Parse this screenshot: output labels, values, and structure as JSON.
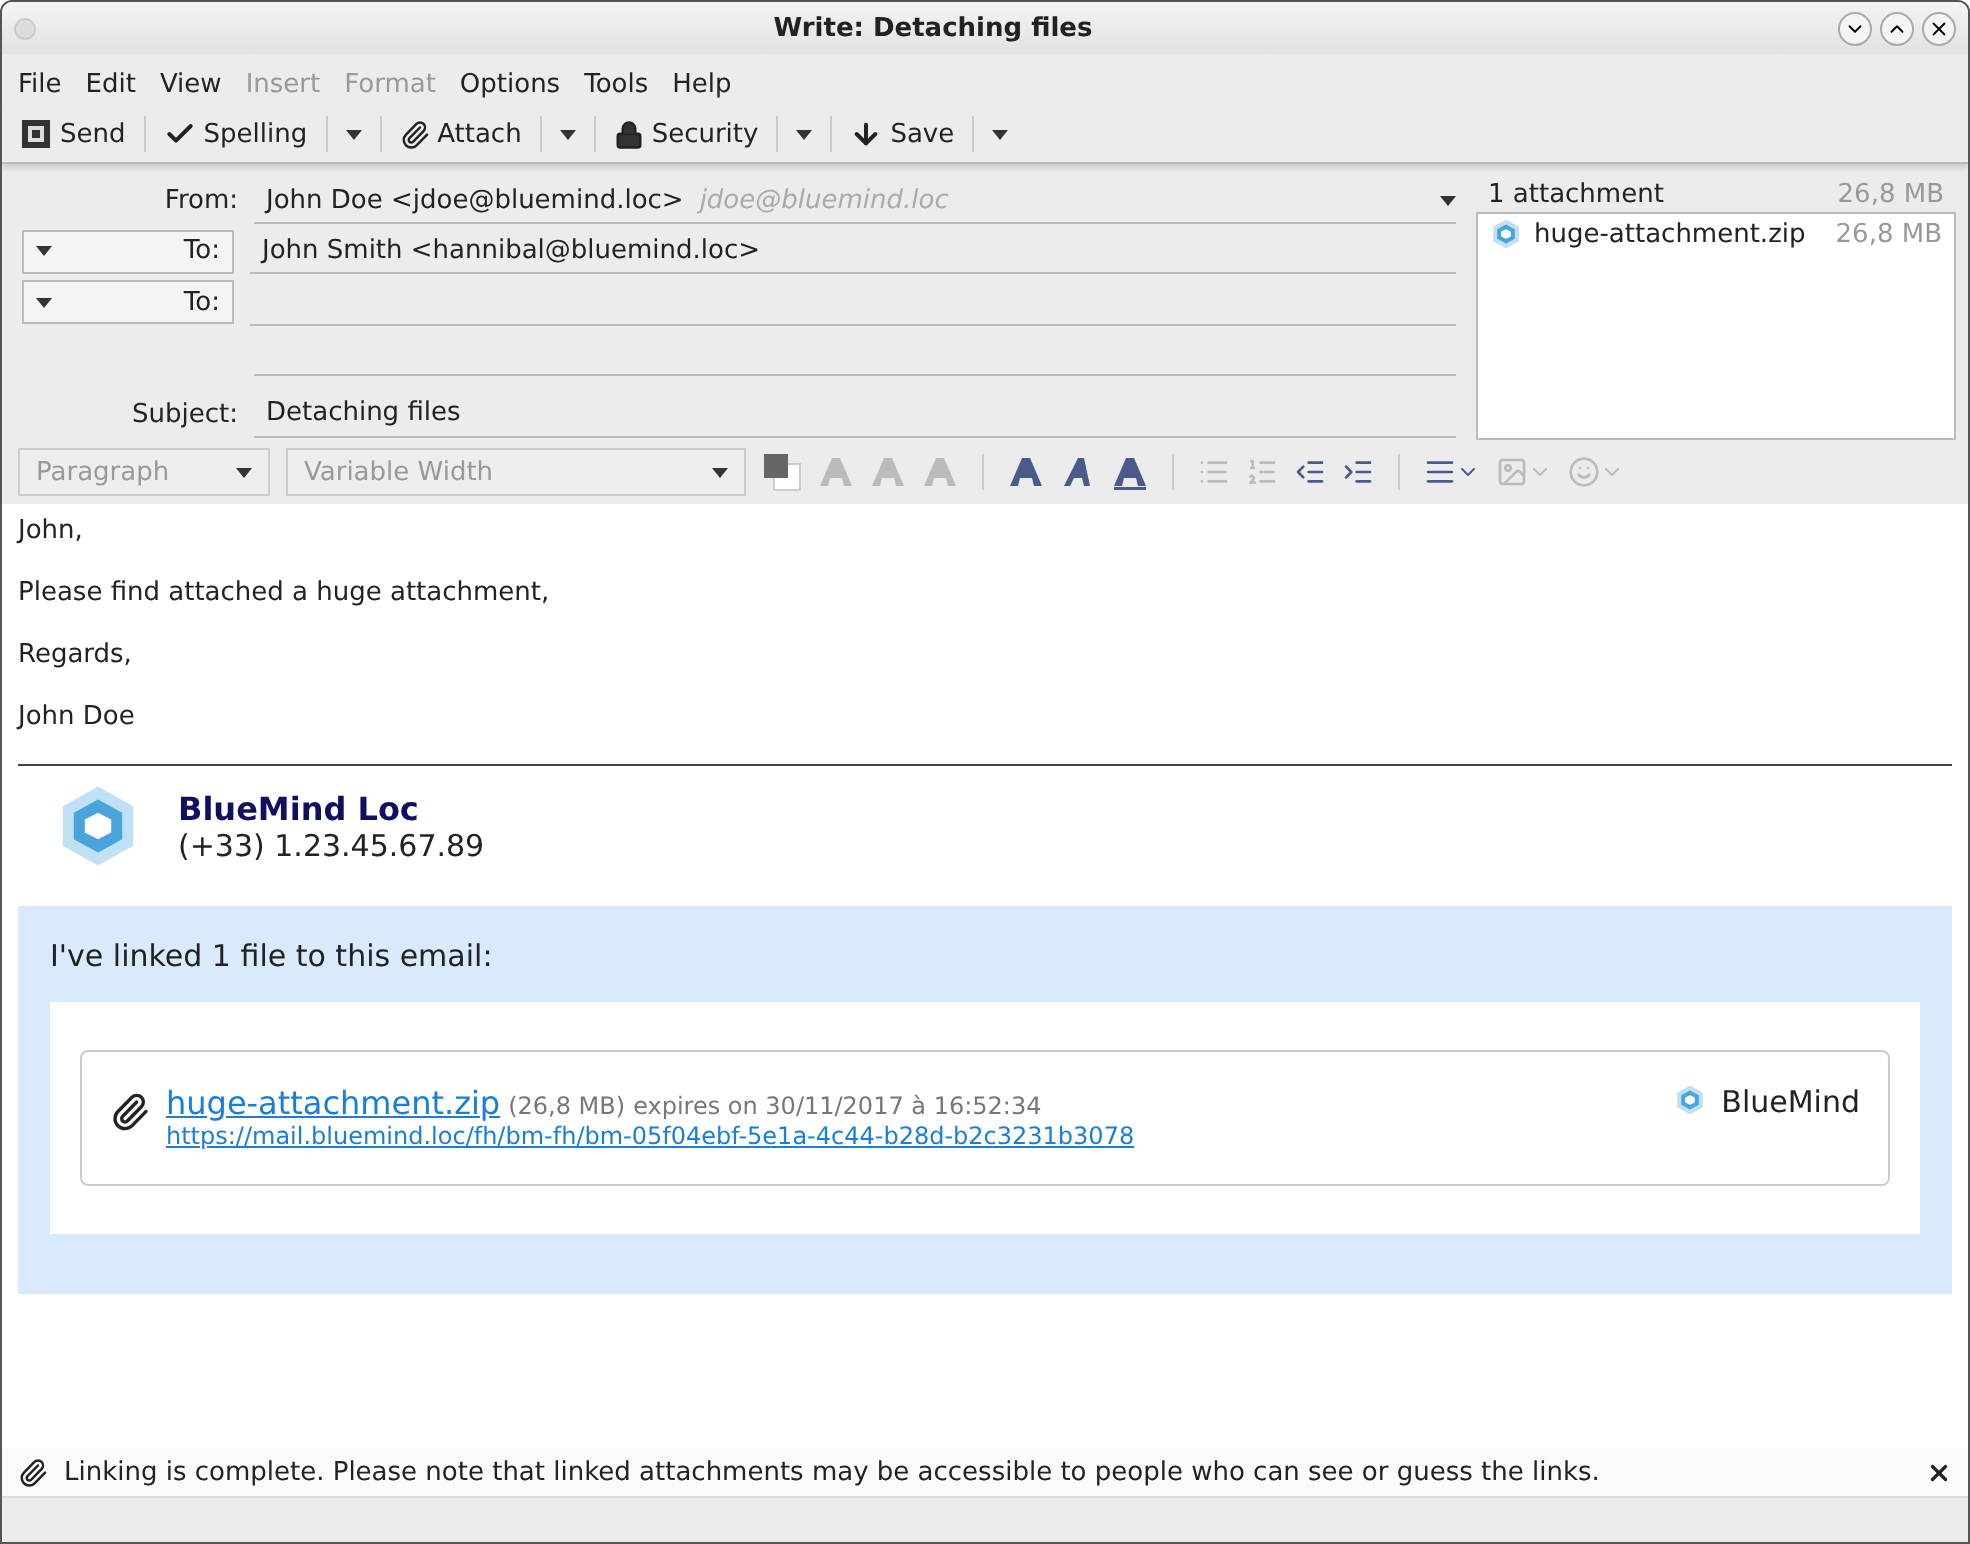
{
  "window": {
    "title": "Write: Detaching files"
  },
  "menu": [
    {
      "label": "File",
      "disabled": false
    },
    {
      "label": "Edit",
      "disabled": false
    },
    {
      "label": "View",
      "disabled": false
    },
    {
      "label": "Insert",
      "disabled": true
    },
    {
      "label": "Format",
      "disabled": true
    },
    {
      "label": "Options",
      "disabled": false
    },
    {
      "label": "Tools",
      "disabled": false
    },
    {
      "label": "Help",
      "disabled": false
    }
  ],
  "toolbar": [
    {
      "kind": "send",
      "label": "Send",
      "dropdown": false
    },
    {
      "kind": "spelling",
      "label": "Spelling",
      "dropdown": true
    },
    {
      "kind": "attach",
      "label": "Attach",
      "dropdown": true
    },
    {
      "kind": "security",
      "label": "Security",
      "dropdown": true
    },
    {
      "kind": "save",
      "label": "Save",
      "dropdown": true
    }
  ],
  "header": {
    "from": {
      "label": "From:",
      "value": "John Doe <jdoe@bluemind.loc>",
      "identity": "jdoe@bluemind.loc"
    },
    "recipients": [
      {
        "label": "To:",
        "value": "John Smith <hannibal@bluemind.loc>"
      },
      {
        "label": "To:"
      }
    ],
    "subject": {
      "label": "Subject:",
      "value": "Detaching files"
    }
  },
  "attachments": {
    "summary": "1 attachment",
    "total": "26,8 MB",
    "items": [
      {
        "name": "huge-attachment.zip",
        "size": "26,8 MB"
      }
    ]
  },
  "format_bar": {
    "paragraph": "Paragraph",
    "font": "Variable Width",
    "tools": [
      {
        "kind": "color"
      },
      {
        "kind": "size",
        "disabled": true
      },
      {
        "kind": "smaller",
        "disabled": true
      },
      {
        "kind": "larger",
        "disabled": true
      },
      {
        "kind": "sep"
      },
      {
        "kind": "bold",
        "disabled": false
      },
      {
        "kind": "italic",
        "disabled": false
      },
      {
        "kind": "underline",
        "disabled": false
      },
      {
        "kind": "sep"
      },
      {
        "kind": "bullets",
        "disabled": true
      },
      {
        "kind": "numbers",
        "disabled": true
      },
      {
        "kind": "outdent",
        "disabled": false
      },
      {
        "kind": "indent",
        "disabled": false
      },
      {
        "kind": "sep"
      },
      {
        "kind": "align",
        "disabled": false
      },
      {
        "kind": "image",
        "disabled": true
      },
      {
        "kind": "smiley",
        "disabled": true
      }
    ]
  },
  "body": {
    "paragraphs": [
      "John,",
      "Please find attached a huge attachment,",
      "Regards,",
      "John Doe"
    ],
    "signature": {
      "name": "BlueMind Loc",
      "phone": "(+33) 1.23.45.67.89"
    },
    "linked": {
      "intro": "I've linked 1 file to this email:",
      "file": "huge-attachment.zip",
      "size": "(26,8 MB)",
      "expires": "expires on 30/11/2017 à 16:52:34",
      "url": "https://mail.bluemind.loc/fh/bm-fh/bm-05f04ebf-5e1a-4c44-b28d-b2c3231b3078",
      "brand": "BlueMind"
    }
  },
  "status_bar": {
    "message": "Linking is complete. Please note that linked attachments may be accessible to people who can see or guess the links."
  }
}
